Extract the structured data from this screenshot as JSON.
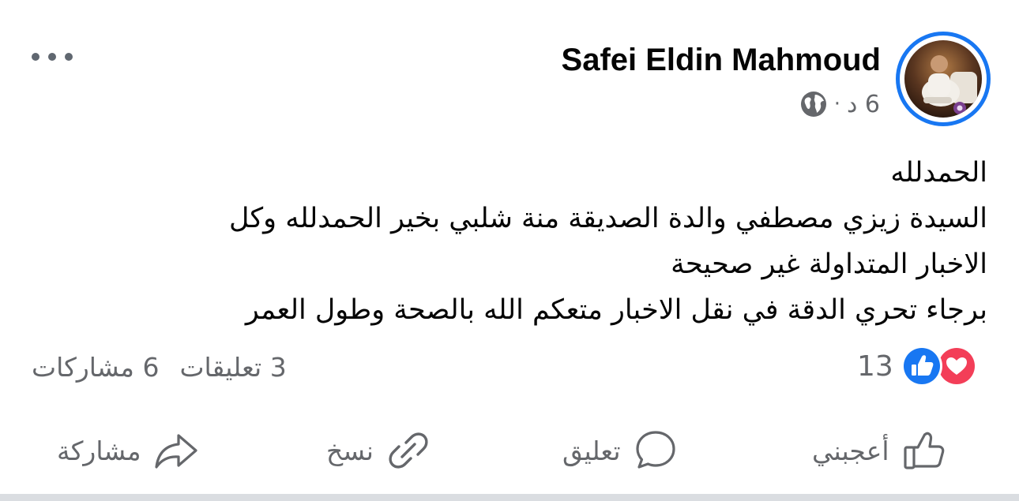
{
  "post": {
    "author": "Safei Eldin Mahmoud",
    "time": "6 د",
    "separator": "·",
    "privacy_icon": "globe-icon",
    "avatar_icon": "profile-photo"
  },
  "body": {
    "lines": [
      "الحمدلله",
      "السيدة زيزي مصطفي والدة الصديقة منة شلبي بخير الحمدلله وكل",
      "الاخبار المتداولة غير صحيحة",
      "برجاء تحري الدقة في نقل الاخبار متعكم الله بالصحة وطول العمر"
    ]
  },
  "reactions": {
    "count": "13",
    "types": [
      "like-icon",
      "love-icon"
    ]
  },
  "stats": {
    "comments": "3 تعليقات",
    "shares": "6 مشاركات"
  },
  "actions": {
    "like": "أعجبني",
    "comment": "تعليق",
    "copy": "نسخ",
    "share": "مشاركة"
  },
  "colors": {
    "accent": "#1877f2",
    "love": "#f33e58",
    "secondary_text": "#65676b"
  }
}
